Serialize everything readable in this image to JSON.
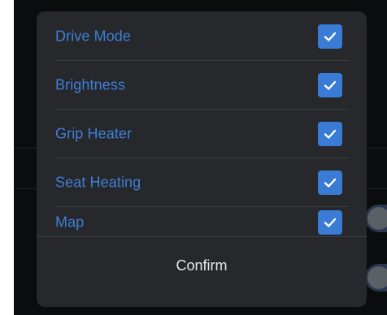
{
  "dialog": {
    "options": [
      {
        "label": "Drive Mode",
        "checked": true
      },
      {
        "label": "Brightness",
        "checked": true
      },
      {
        "label": "Grip Heater",
        "checked": true
      },
      {
        "label": "Seat Heating",
        "checked": true
      },
      {
        "label": "Map",
        "checked": true
      }
    ],
    "confirm_label": "Confirm"
  },
  "colors": {
    "accent": "#3a7bd5",
    "label_text": "#3f7fd6",
    "dialog_bg": "#26282c",
    "screen_bg": "#0b0c0e"
  },
  "icons": {
    "checkbox": "check-icon"
  }
}
